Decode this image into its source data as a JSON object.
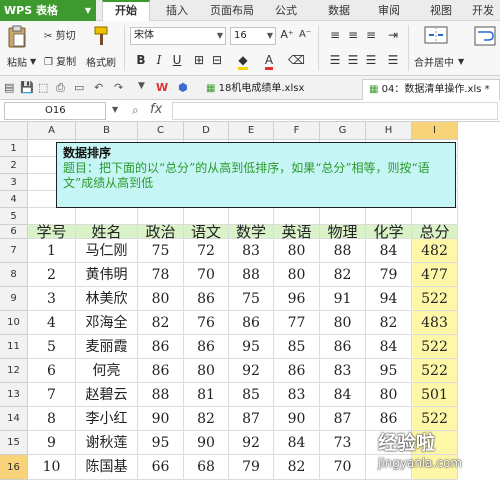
{
  "app": {
    "name": "WPS 表格",
    "tabs": [
      "开始",
      "插入",
      "页面布局",
      "公式",
      "数据",
      "审阅",
      "视图",
      "开发"
    ]
  },
  "ribbon": {
    "paste_label": "粘贴",
    "cut_label": "剪切",
    "copy_label": "复制",
    "format_painter_label": "格式刷",
    "font_name": "宋体",
    "font_size": "16",
    "merge_center_label": "合并居中",
    "bold": "B",
    "italic": "I",
    "underline": "U"
  },
  "doc_tabs": [
    {
      "label": "18机电成绩单.xlsx",
      "active": false
    },
    {
      "label": "04：数据清单操作.xls *",
      "active": true
    }
  ],
  "formula_bar": {
    "name_box": "O16",
    "fx": "fx",
    "formula": ""
  },
  "sheet": {
    "columns": [
      "A",
      "B",
      "C",
      "D",
      "E",
      "F",
      "G",
      "H",
      "I"
    ],
    "selected_column": "I",
    "row_numbers": [
      "1",
      "2",
      "3",
      "4",
      "5",
      "6",
      "7",
      "8",
      "9",
      "10",
      "11",
      "12",
      "13",
      "14",
      "15",
      "16"
    ],
    "selected_row": "16",
    "note": {
      "title": "数据排序",
      "body": "题目：把下面的以“总分”的从高到低排序，如果“总分”相等，则按“语文”成绩从高到低"
    },
    "table": {
      "headers": [
        "学号",
        "姓名",
        "政治",
        "语文",
        "数学",
        "英语",
        "物理",
        "化学",
        "总分"
      ],
      "rows": [
        [
          "1",
          "马仁刚",
          "75",
          "72",
          "83",
          "80",
          "88",
          "84",
          "482"
        ],
        [
          "2",
          "黄伟明",
          "78",
          "70",
          "88",
          "80",
          "82",
          "79",
          "477"
        ],
        [
          "3",
          "林美欣",
          "80",
          "86",
          "75",
          "96",
          "91",
          "94",
          "522"
        ],
        [
          "4",
          "邓海全",
          "82",
          "76",
          "86",
          "77",
          "80",
          "82",
          "483"
        ],
        [
          "5",
          "麦丽霞",
          "86",
          "86",
          "95",
          "85",
          "86",
          "84",
          "522"
        ],
        [
          "6",
          "何亮",
          "86",
          "80",
          "92",
          "86",
          "83",
          "95",
          "522"
        ],
        [
          "7",
          "赵碧云",
          "88",
          "81",
          "85",
          "83",
          "84",
          "80",
          "501"
        ],
        [
          "8",
          "李小红",
          "90",
          "82",
          "87",
          "90",
          "87",
          "86",
          "522"
        ],
        [
          "9",
          "谢秋莲",
          "95",
          "90",
          "92",
          "84",
          "73",
          "",
          ""
        ],
        [
          "10",
          "陈国基",
          "66",
          "68",
          "79",
          "82",
          "70",
          "",
          ""
        ]
      ]
    }
  },
  "watermark": {
    "text": "经验啦",
    "url": "jingyanla.com"
  },
  "colors": {
    "brand_green": "#3e9a2f",
    "header_fill": "#d9f2c8",
    "total_fill": "#fff7a8",
    "note_fill": "#c6f5f5",
    "note_text": "#2a9a2a",
    "selection_header": "#f8d37a"
  }
}
